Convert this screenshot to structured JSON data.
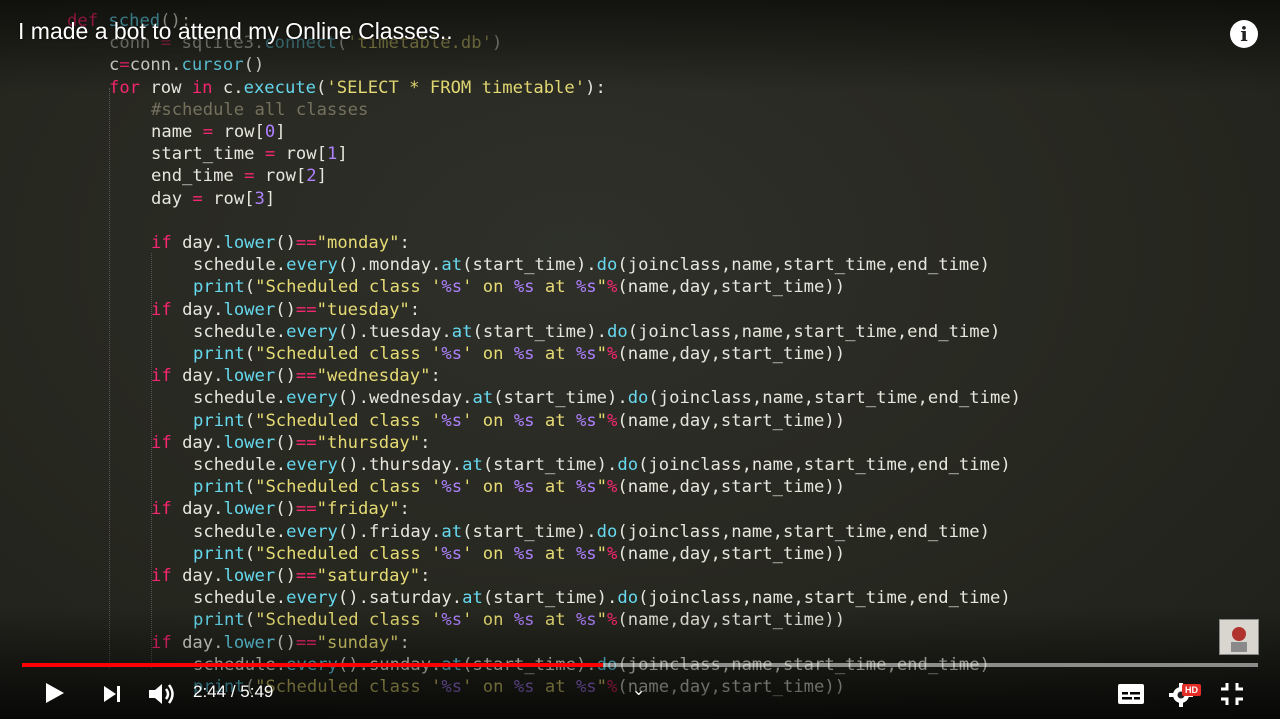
{
  "video": {
    "title": "I made a bot to attend my Online Classes..",
    "info_icon": "i"
  },
  "code_lines": [
    {
      "t": "def sched():",
      "k": "def"
    },
    {
      "t": "conn = sqlite3.connect('timetable.db')",
      "k": "dim"
    },
    {
      "t": "c=conn.cursor()"
    },
    {
      "t": "for row in c.execute('SELECT * FROM timetable'):"
    },
    {
      "t": "#schedule all classes"
    },
    {
      "t": "name = row[0]"
    },
    {
      "t": "start_time = row[1]"
    },
    {
      "t": "end_time = row[2]"
    },
    {
      "t": "day = row[3]"
    },
    {
      "t": ""
    },
    {
      "t": "if day.lower()==\"monday\":"
    },
    {
      "t": "schedule.every().monday.at(start_time).do(joinclass,name,start_time,end_time)"
    },
    {
      "t": "print(\"Scheduled class '%s' on %s at %s\"%(name,day,start_time))"
    },
    {
      "t": "if day.lower()==\"tuesday\":"
    },
    {
      "t": "schedule.every().tuesday.at(start_time).do(joinclass,name,start_time,end_time)"
    },
    {
      "t": "print(\"Scheduled class '%s' on %s at %s\"%(name,day,start_time))"
    },
    {
      "t": "if day.lower()==\"wednesday\":"
    },
    {
      "t": "schedule.every().wednesday.at(start_time).do(joinclass,name,start_time,end_time)"
    },
    {
      "t": "print(\"Scheduled class '%s' on %s at %s\"%(name,day,start_time))"
    },
    {
      "t": "if day.lower()==\"thursday\":"
    },
    {
      "t": "schedule.every().thursday.at(start_time).do(joinclass,name,start_time,end_time)"
    },
    {
      "t": "print(\"Scheduled class '%s' on %s at %s\"%(name,day,start_time))"
    },
    {
      "t": "if day.lower()==\"friday\":"
    },
    {
      "t": "schedule.every().friday.at(start_time).do(joinclass,name,start_time,end_time)"
    },
    {
      "t": "print(\"Scheduled class '%s' on %s at %s\"%(name,day,start_time))"
    },
    {
      "t": "if day.lower()==\"saturday\":"
    },
    {
      "t": "schedule.every().saturday.at(start_time).do(joinclass,name,start_time,end_time)"
    },
    {
      "t": "print(\"Scheduled class '%s' on %s at %s\"%(name,day,start_time))"
    },
    {
      "t": "if day.lower()==\"sunday\":"
    },
    {
      "t": "schedule.every().sunday.at(start_time).do(joinclass,name,start_time,end_time)"
    },
    {
      "t": "print(\"Scheduled class '%s' on %s at %s\"%(name,day,start_time))"
    }
  ],
  "player": {
    "current_time": "2:44",
    "separator": " / ",
    "duration": "5:49",
    "played_fraction": 0.47,
    "loaded_fraction": 1.0,
    "hd_badge": "HD",
    "icons": [
      "play-icon",
      "next-icon",
      "volume-icon",
      "chevron-down-icon",
      "subtitles-icon",
      "settings-icon",
      "exit-fullscreen-icon",
      "info-icon"
    ],
    "colors": {
      "progress": "#ff0000",
      "hd_badge": "#e52d27"
    }
  }
}
